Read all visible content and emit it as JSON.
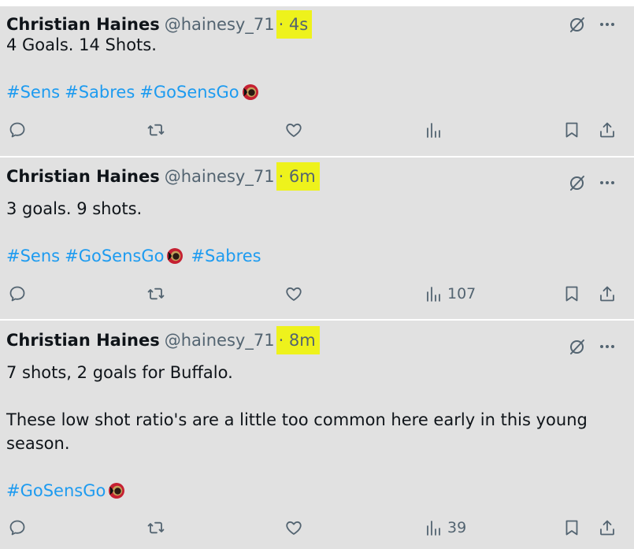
{
  "tweets": [
    {
      "name": "Christian Haines",
      "handle": "@hainesy_71",
      "time": "· 4s",
      "lines": [
        "4 Goals. 14 Shots."
      ],
      "tags": [
        "#Sens",
        "#Sabres",
        "#GoSensGo"
      ],
      "views": ""
    },
    {
      "name": "Christian Haines",
      "handle": "@hainesy_71",
      "time": "· 6m",
      "lines": [
        "3 goals. 9  shots."
      ],
      "tags": [
        "#Sens",
        "#GoSensGo",
        "#Sabres"
      ],
      "views": "107"
    },
    {
      "name": "Christian Haines",
      "handle": "@hainesy_71",
      "time": "· 8m",
      "lines": [
        "7 shots, 2 goals for Buffalo.",
        "These low shot ratio's are a little too common here early in this young",
        "season."
      ],
      "tags": [
        "#GoSensGo"
      ],
      "views": "39"
    }
  ],
  "icons": {
    "reply": "reply-icon",
    "retweet": "retweet-icon",
    "like": "heart-icon",
    "views": "views-icon",
    "bookmark": "bookmark-icon",
    "share": "share-icon",
    "grok": "grok-icon",
    "more": "more-icon",
    "emoji": "senators-logo-icon"
  },
  "colors": {
    "link": "#1d9bf0",
    "muted": "#536471",
    "highlight": "#eef21c",
    "card": "#e1e1e1"
  }
}
